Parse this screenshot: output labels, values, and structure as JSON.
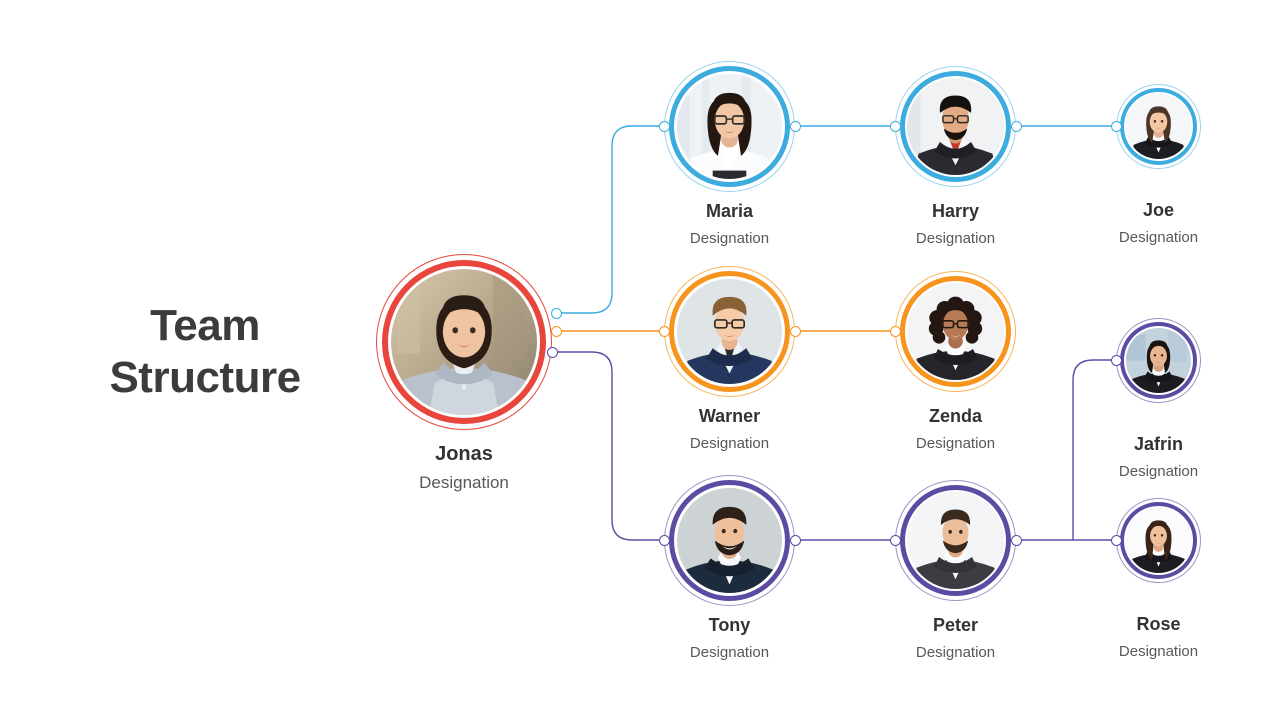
{
  "title": "Team\nStructure",
  "colors": {
    "root": "#e8453c",
    "blue": "#3cacdf",
    "orange": "#f7941e",
    "purple": "#5b4ba3",
    "name_text": "#333333",
    "designation_text": "#56585c",
    "title_text": "#3c3c3c",
    "background": "#ffffff"
  },
  "root": {
    "name": "Jonas",
    "designation": "Designation"
  },
  "branches": [
    {
      "id": "blue-branch",
      "color": "#3cacdf",
      "members": [
        {
          "name": "Maria",
          "designation": "Designation"
        },
        {
          "name": "Harry",
          "designation": "Designation"
        },
        {
          "name": "Joe",
          "designation": "Designation"
        }
      ]
    },
    {
      "id": "orange-branch",
      "color": "#f7941e",
      "members": [
        {
          "name": "Warner",
          "designation": "Designation"
        },
        {
          "name": "Zenda",
          "designation": "Designation"
        }
      ]
    },
    {
      "id": "purple-branch",
      "color": "#5b4ba3",
      "members": [
        {
          "name": "Tony",
          "designation": "Designation"
        },
        {
          "name": "Peter",
          "designation": "Designation"
        },
        {
          "name": "Jafrin",
          "designation": "Designation"
        },
        {
          "name": "Rose",
          "designation": "Designation"
        }
      ]
    }
  ],
  "nodes": {
    "jonas": {
      "name": "Jonas",
      "designation": "Designation"
    },
    "maria": {
      "name": "Maria",
      "designation": "Designation"
    },
    "harry": {
      "name": "Harry",
      "designation": "Designation"
    },
    "joe": {
      "name": "Joe",
      "designation": "Designation"
    },
    "warner": {
      "name": "Warner",
      "designation": "Designation"
    },
    "zenda": {
      "name": "Zenda",
      "designation": "Designation"
    },
    "tony": {
      "name": "Tony",
      "designation": "Designation"
    },
    "peter": {
      "name": "Peter",
      "designation": "Designation"
    },
    "jafrin": {
      "name": "Jafrin",
      "designation": "Designation"
    },
    "rose": {
      "name": "Rose",
      "designation": "Designation"
    }
  }
}
